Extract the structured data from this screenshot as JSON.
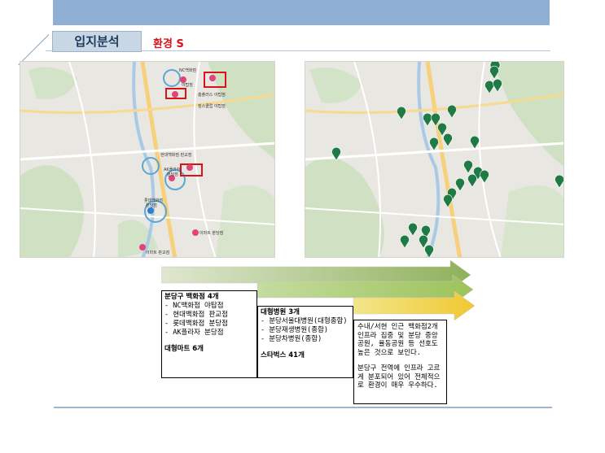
{
  "header": {
    "tag": "입지분석",
    "subtitle": "환경 S"
  },
  "left_map": {
    "labels": [
      "NC백화점",
      "야탑점",
      "AK플라자",
      "분당점",
      "현대백화점 판교점",
      "롯데백화점",
      "분당점",
      "홈플러스 야탑점",
      "킴스클럽 야탑점",
      "이마트 분당점",
      "이마트 판교점"
    ]
  },
  "colors": {
    "arrow": "#7aa050",
    "tag_bg": "#c9d6e3",
    "subtitle": "#d7141a"
  },
  "panels": {
    "p1": {
      "heading": "분당구 백화점 4개",
      "items": [
        "- NC백화점 야탑점",
        "- 현대백화점 판교점",
        "- 롯데백화점 분당점",
        "- AK플라자 분당점"
      ],
      "footer": "대형마트 6개"
    },
    "p2": {
      "heading": "대형병원 3개",
      "items": [
        "- 분당서울대병원(대형종합)",
        "- 분당재생병원(종합)",
        "- 분당차병원(종합)"
      ],
      "footer": "스타벅스 41개"
    },
    "p3": {
      "para1": "수내/서현 인근 백화점2개 인프라 집중 및 분당 중앙 공원, 율동공원 등 선호도 높은 것으로 보인다.",
      "para2": "분당구 전역에 인프라 고르게 분포되어 있어 전체적으로 환경이 매우 우수하다."
    }
  }
}
